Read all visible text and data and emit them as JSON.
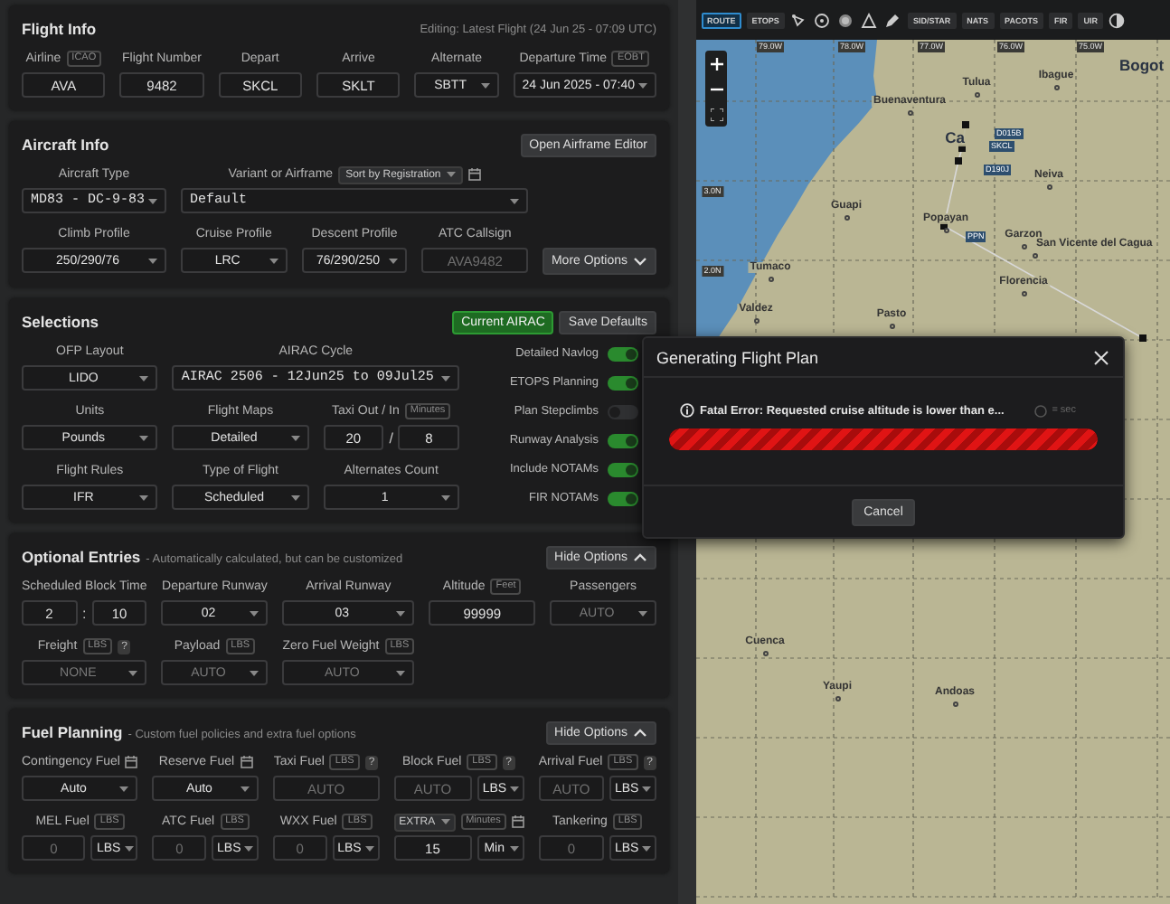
{
  "sections": [
    {
      "title": "Flight Info",
      "note": "Editing: Latest Flight (24 Jun 25 - 07:09 UTC)",
      "rows": [
        [
          {
            "label": "Airline",
            "tags": [
              "ICAO"
            ],
            "kind": "text",
            "value": "AVA"
          },
          {
            "label": "Flight Number",
            "kind": "text",
            "value": "9482"
          },
          {
            "label": "Depart",
            "kind": "text",
            "value": "SKCL"
          },
          {
            "label": "Arrive",
            "kind": "text",
            "value": "SKLT"
          },
          {
            "label": "Alternate",
            "kind": "select",
            "value": "SBTT"
          },
          {
            "label": "Departure Time",
            "tags": [
              "EOBT"
            ],
            "kind": "select",
            "value": "24 Jun 2025 - 07:40"
          }
        ]
      ]
    },
    {
      "title": "Aircraft Info",
      "buttons": [
        {
          "label": "Open Airframe Editor",
          "kind": "default"
        }
      ],
      "rows": [
        [
          {
            "label": "Aircraft Type",
            "kind": "select",
            "mono": true,
            "value": "MD83 - DC-9-83"
          },
          {
            "label": "Variant or Airframe",
            "sort": "Sort by Registration",
            "picker": true,
            "kind": "select",
            "mono": true,
            "value": "Default"
          }
        ],
        [
          {
            "label": "Climb Profile",
            "kind": "select",
            "value": "250/290/76"
          },
          {
            "label": "Cruise Profile",
            "kind": "select",
            "value": "LRC"
          },
          {
            "label": "Descent Profile",
            "kind": "select",
            "value": "76/290/250"
          },
          {
            "label": "ATC Callsign",
            "kind": "text",
            "placeholder": "AVA9482"
          },
          {
            "kind": "button",
            "label": "More Options",
            "expanded": false
          }
        ]
      ]
    },
    {
      "title": "Selections",
      "buttons": [
        {
          "label": "Current AIRAC",
          "kind": "primary"
        },
        {
          "label": "Save Defaults",
          "kind": "default"
        }
      ],
      "rows": [
        [
          {
            "label": "OFP Layout",
            "kind": "select",
            "value": "LIDO"
          },
          {
            "label": "AIRAC Cycle",
            "kind": "select",
            "mono": true,
            "value": "AIRAC 2506 - 12Jun25 to 09Jul25"
          }
        ],
        [
          {
            "label": "Units",
            "kind": "select",
            "value": "Pounds"
          },
          {
            "label": "Flight Maps",
            "kind": "select",
            "value": "Detailed"
          },
          {
            "label": "Taxi Out / In",
            "tags": [
              "Minutes"
            ],
            "kind": "pair",
            "values": [
              "20",
              "8"
            ],
            "separator": "/"
          }
        ],
        [
          {
            "label": "Flight Rules",
            "kind": "select",
            "value": "IFR"
          },
          {
            "label": "Type of Flight",
            "kind": "select",
            "value": "Scheduled"
          },
          {
            "label": "Alternates Count",
            "kind": "select",
            "value": "1"
          }
        ]
      ],
      "toggles": [
        {
          "label": "Detailed Navlog",
          "on": true
        },
        {
          "label": "ETOPS Planning",
          "on": true
        },
        {
          "label": "Plan Stepclimbs",
          "on": false
        },
        {
          "label": "Runway Analysis",
          "on": true
        },
        {
          "label": "Include NOTAMs",
          "on": true
        },
        {
          "label": "FIR NOTAMs",
          "on": true
        }
      ]
    },
    {
      "title": "Optional Entries",
      "subtitle": "- Automatically calculated, but can be customized",
      "buttons": [
        {
          "label": "Hide Options",
          "kind": "default",
          "expanded": true
        }
      ],
      "rows": [
        [
          {
            "label": "Scheduled Block Time",
            "kind": "pair",
            "values": [
              "2",
              "10"
            ],
            "separator": ":"
          },
          {
            "label": "Departure Runway",
            "kind": "select",
            "value": "02"
          },
          {
            "label": "Arrival Runway",
            "kind": "select",
            "value": "03"
          },
          {
            "label": "Altitude",
            "tags": [
              "Feet"
            ],
            "kind": "text",
            "value": "99999"
          },
          {
            "label": "Passengers",
            "kind": "select",
            "placeholder": "AUTO"
          }
        ],
        [
          {
            "label": "Freight",
            "tags": [
              "LBS"
            ],
            "help": "?",
            "kind": "select",
            "placeholder": "NONE"
          },
          {
            "label": "Payload",
            "tags": [
              "LBS"
            ],
            "kind": "select",
            "placeholder": "AUTO"
          },
          {
            "label": "Zero Fuel Weight",
            "tags": [
              "LBS"
            ],
            "kind": "select",
            "placeholder": "AUTO"
          }
        ]
      ]
    },
    {
      "title": "Fuel Planning",
      "subtitle": "- Custom fuel policies and extra fuel options",
      "buttons": [
        {
          "label": "Hide Options",
          "kind": "default",
          "expanded": true
        }
      ],
      "rows": [
        [
          {
            "label": "Contingency Fuel",
            "picker": true,
            "kind": "select",
            "value": "Auto"
          },
          {
            "label": "Reserve Fuel",
            "picker": true,
            "kind": "select",
            "value": "Auto"
          },
          {
            "label": "Taxi Fuel",
            "tags": [
              "LBS"
            ],
            "help": "?",
            "kind": "text",
            "placeholder": "AUTO"
          },
          {
            "label": "Block Fuel",
            "tags": [
              "LBS"
            ],
            "help": "?",
            "kind": "unit",
            "placeholder": "AUTO",
            "unit": "LBS"
          },
          {
            "label": "Arrival Fuel",
            "tags": [
              "LBS"
            ],
            "help": "?",
            "kind": "unit",
            "placeholder": "AUTO",
            "unit": "LBS"
          }
        ],
        [
          {
            "label": "MEL Fuel",
            "tags": [
              "LBS"
            ],
            "kind": "unit",
            "placeholder": "0",
            "unit": "LBS"
          },
          {
            "label": "ATC Fuel",
            "tags": [
              "LBS"
            ],
            "kind": "unit",
            "placeholder": "0",
            "unit": "LBS"
          },
          {
            "label": "WXX Fuel",
            "tags": [
              "LBS"
            ],
            "kind": "unit",
            "placeholder": "0",
            "unit": "LBS"
          },
          {
            "label_select": "EXTRA",
            "tags": [
              "Minutes"
            ],
            "picker": true,
            "kind": "unit",
            "value": "15",
            "unit": "Min"
          },
          {
            "label": "Tankering",
            "tags": [
              "LBS"
            ],
            "kind": "unit",
            "placeholder": "0",
            "unit": "LBS"
          }
        ]
      ]
    }
  ],
  "map": {
    "toolbar_left": [
      {
        "label": "ROUTE",
        "selected": true
      },
      {
        "label": "ETOPS",
        "selected": false
      }
    ],
    "toolbar_right": [
      {
        "label": "SID/STAR",
        "selected": false
      },
      {
        "label": "NATS",
        "selected": false
      },
      {
        "label": "PACOTS",
        "selected": false
      },
      {
        "label": "FIR",
        "selected": false
      },
      {
        "label": "UIR",
        "selected": false
      }
    ],
    "lon_labels": [
      "79.0W",
      "78.0W",
      "77.0W",
      "76.0W",
      "75.0W"
    ],
    "lat_labels": [
      "3.0N",
      "2.0N"
    ],
    "places": [
      "Bogot",
      "Tulua",
      "Ibague",
      "Buenaventura",
      "Ca",
      "Neiva",
      "Guapi",
      "Popayan",
      "Garzon",
      "San Vicente del Cagua",
      "Tumaco",
      "Florencia",
      "Valdez",
      "Pasto",
      "Cuenca",
      "Yaupi",
      "Andoas"
    ],
    "waypoints": [
      "D015B",
      "SKCL",
      "D190J",
      "PPN"
    ]
  },
  "modal": {
    "title": "Generating Flight Plan",
    "message": "Fatal Error: Requested cruise altitude is lower than e...",
    "timer": "= sec",
    "level": 1,
    "buttons": [
      "Cancel"
    ]
  }
}
